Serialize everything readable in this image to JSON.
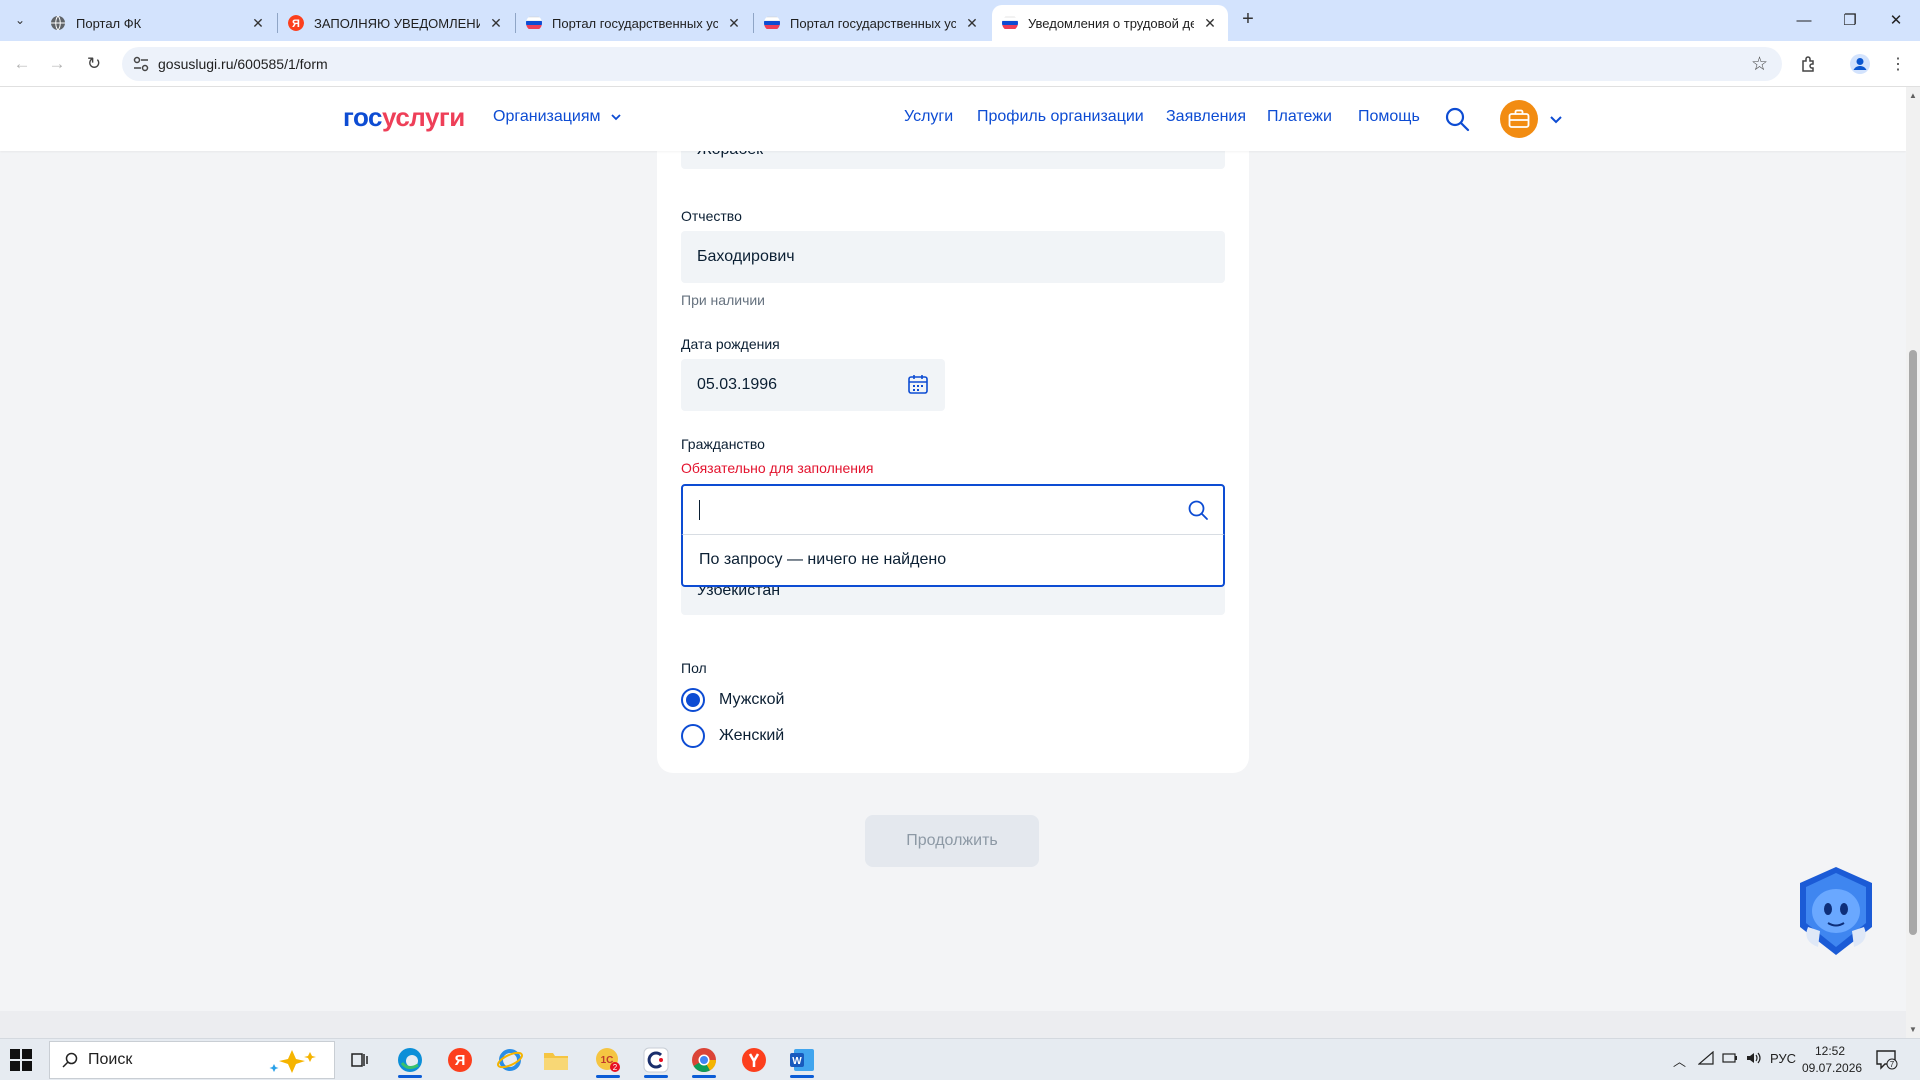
{
  "browser": {
    "tabs": [
      {
        "title": "Портал ФК",
        "active": false
      },
      {
        "title": "ЗАПОЛНЯЮ УВЕДОМЛЕНИЕ Н",
        "active": false
      },
      {
        "title": "Портал государственных услу",
        "active": false
      },
      {
        "title": "Портал государственных услу",
        "active": false
      },
      {
        "title": "Уведомления о трудовой деят",
        "active": true
      }
    ],
    "url": "gosuslugi.ru/600585/1/form"
  },
  "header": {
    "logo_part1": "гос",
    "logo_part2": "услуги",
    "org_menu": "Организациям",
    "nav": [
      "Услуги",
      "Профиль организации",
      "Заявления",
      "Платежи",
      "Помощь"
    ]
  },
  "form": {
    "name_value": "Жорабек",
    "patronymic_label": "Отчество",
    "patronymic_value": "Баходирович",
    "patronymic_hint": "При наличии",
    "birthdate_label": "Дата рождения",
    "birthdate_value": "05.03.1996",
    "citizenship_label": "Гражданство",
    "citizenship_error": "Обязательно для заполнения",
    "citizenship_input_value": "",
    "dropdown_empty_message": "По запросу — ничего не найдено",
    "citizenship_previous_value": "Узбекистан",
    "gender_label": "Пол",
    "gender_options": [
      {
        "label": "Мужской",
        "selected": true
      },
      {
        "label": "Женский",
        "selected": false
      }
    ],
    "continue_label": "Продолжить"
  },
  "taskbar": {
    "search_placeholder": "Поиск",
    "language": "РУС",
    "time": "12:52",
    "date": "09.07.2026",
    "notification_count": "7"
  },
  "colors": {
    "brand_blue": "#0d4cd3",
    "brand_red": "#ee3f58",
    "error_red": "#e3132e",
    "field_bg": "#f1f4f7"
  }
}
